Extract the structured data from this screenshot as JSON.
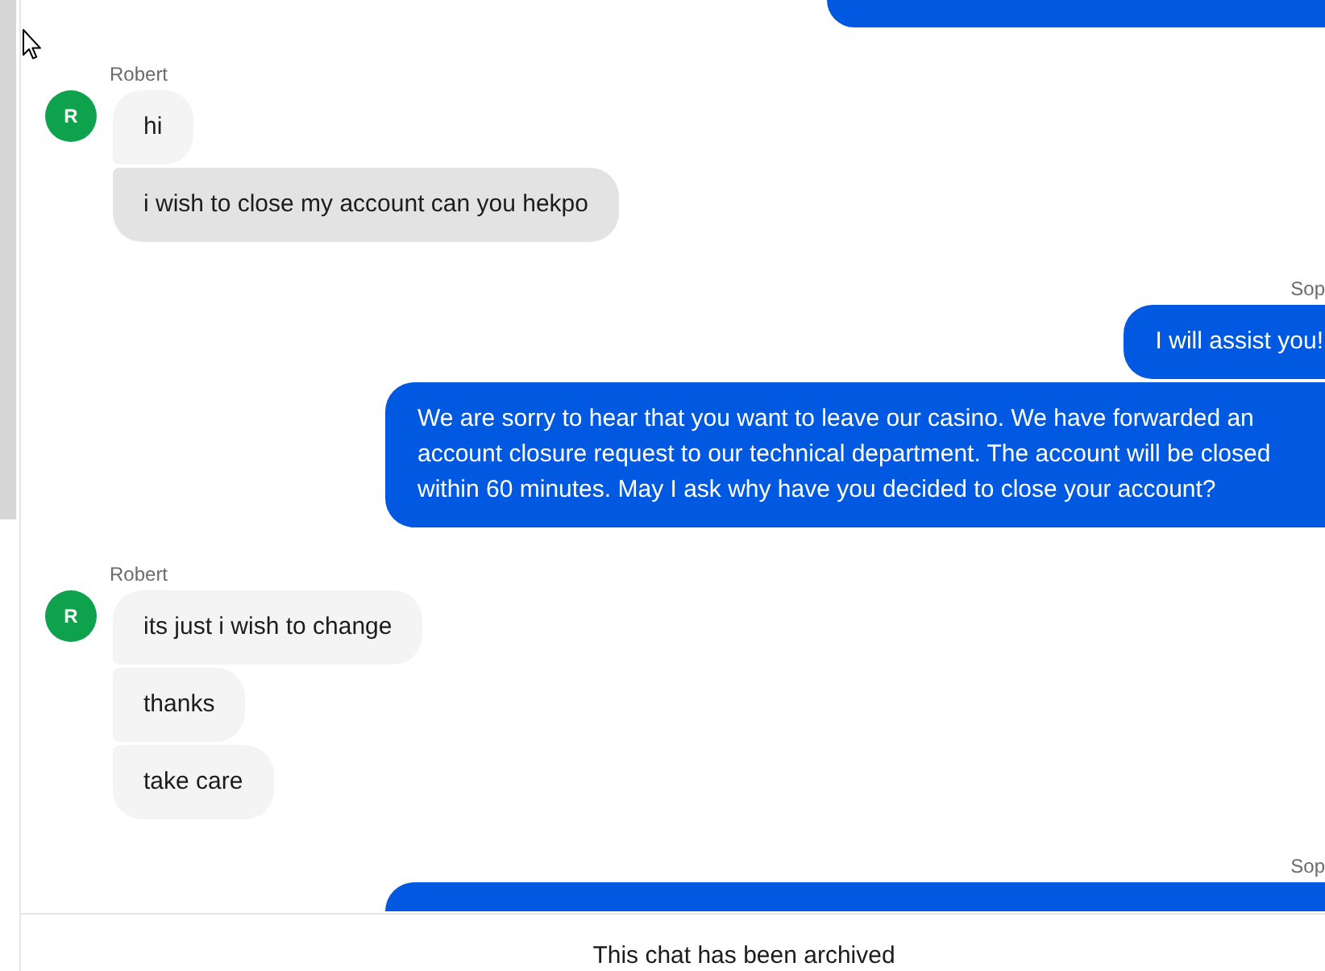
{
  "conversation": [
    {
      "kind": "agent",
      "messages": [
        {
          "kind": "headstub"
        }
      ]
    },
    {
      "kind": "customer",
      "name": "Robert",
      "avatar": "R",
      "messages": [
        {
          "kind": "text",
          "text": "hi",
          "hovered": false
        },
        {
          "kind": "text",
          "text": "i wish to close my account can you hekpo",
          "hovered": true
        }
      ]
    },
    {
      "kind": "agent",
      "name": "Sop",
      "messages": [
        {
          "kind": "text",
          "text": "I will assist you!",
          "hovered": false
        },
        {
          "kind": "text",
          "text": "We are sorry to hear that you want to leave our casino. We have forwarded an account closure request to our technical department. The account will be closed within 60 minutes. May I ask why have you decided to close your account?",
          "hovered": false
        }
      ]
    },
    {
      "kind": "customer",
      "name": "Robert",
      "avatar": "R",
      "messages": [
        {
          "kind": "text",
          "text": "its just i wish to change",
          "hovered": false
        },
        {
          "kind": "text",
          "text": "thanks",
          "hovered": false
        },
        {
          "kind": "text",
          "text": "take care",
          "hovered": false
        }
      ]
    },
    {
      "kind": "agent",
      "name": "Sop",
      "messages": [
        {
          "kind": "tailstub"
        }
      ]
    }
  ],
  "footer": {
    "notice": "This chat has been archived"
  }
}
